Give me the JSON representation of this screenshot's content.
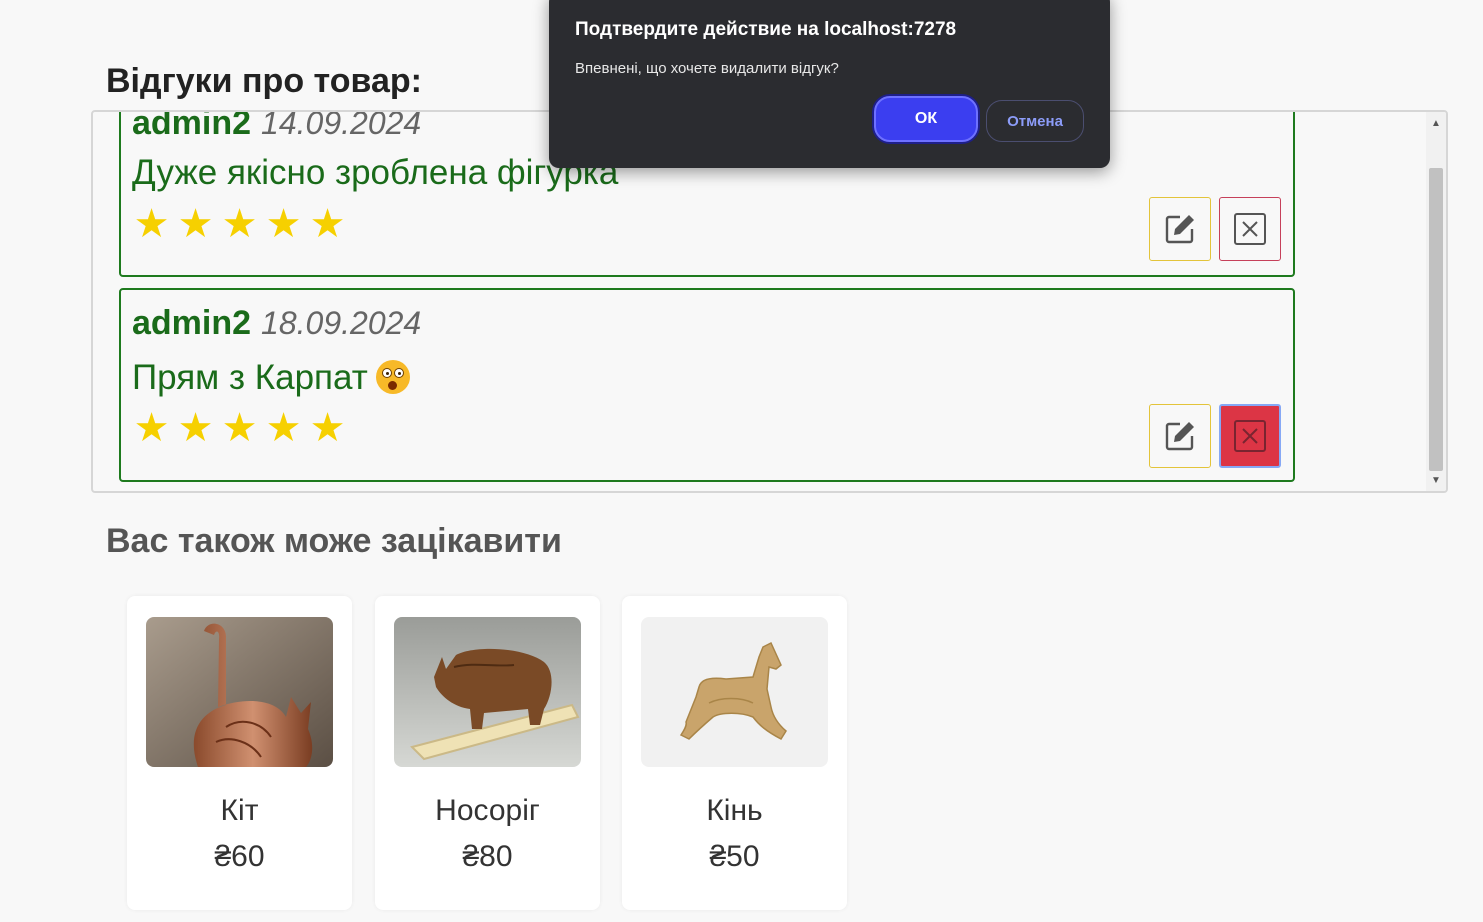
{
  "reviews_section": {
    "heading": "Відгуки про товар:",
    "reviews": [
      {
        "author": "admin2",
        "date": "14.09.2024",
        "text": "Дуже якісно зроблена фігурка",
        "rating": 5
      },
      {
        "author": "admin2",
        "date": "18.09.2024",
        "text": "Прям з Карпат",
        "emoji": "astonished-face-emoji",
        "rating": 5
      }
    ],
    "edit_icon": "edit-icon",
    "delete_icon": "close-box-icon",
    "colors": {
      "review_border": "#1e7a1e",
      "review_text": "#1a6b1a",
      "star": "#f6d000",
      "delete_active": "#dc3545"
    }
  },
  "suggestions": {
    "heading": "Вас також може зацікавити",
    "products": [
      {
        "name": "Кіт",
        "price": "₴60",
        "image": "wooden-cat-figurine"
      },
      {
        "name": "Носоріг",
        "price": "₴80",
        "image": "wooden-rhino-figurine"
      },
      {
        "name": "Кінь",
        "price": "₴50",
        "image": "wooden-horse-figurine"
      }
    ]
  },
  "dialog": {
    "title": "Подтвердите действие на localhost:7278",
    "message": "Впевнені, що хочете видалити відгук?",
    "ok_label": "ОК",
    "cancel_label": "Отмена",
    "colors": {
      "background": "#2b2c30",
      "ok": "#3b3ef0",
      "cancel_text": "#8c9cf8"
    }
  }
}
